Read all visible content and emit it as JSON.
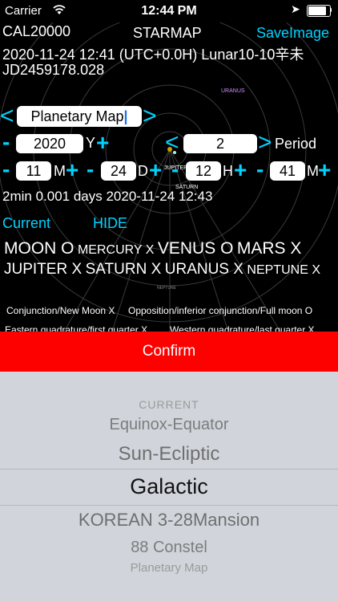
{
  "status": {
    "carrier": "Carrier",
    "time": "12:44 PM"
  },
  "header": {
    "app_id": "CAL20000",
    "title": "STARMAP",
    "save_label": "SaveImage",
    "datetime_line": "2020-11-24 12:41 (UTC+0.0H) Lunar10-10辛未",
    "jd_line": "JD2459178.028"
  },
  "map_labels": {
    "uranus": "URANUS",
    "jupiter": "JUPITER",
    "saturn": "SATURN",
    "neptune": "NEPTUNE"
  },
  "map_mode": {
    "value": "Planetary Map"
  },
  "year": {
    "value": "2020",
    "unit": "Y"
  },
  "period": {
    "value": "2",
    "unit": "Period"
  },
  "month": {
    "value": "11",
    "unit": "M"
  },
  "day": {
    "value": "24",
    "unit": "D"
  },
  "hour": {
    "value": "12",
    "unit": "H"
  },
  "minute": {
    "value": "41",
    "unit": "M"
  },
  "step_line": "2min 0.001 days 2020-11-24 12:43",
  "controls": {
    "current": "Current",
    "hide": "HIDE"
  },
  "planets_row1": [
    {
      "name": "MOON",
      "flag": "O"
    },
    {
      "name": "MERCURY",
      "flag": "X"
    },
    {
      "name": "VENUS",
      "flag": "O"
    },
    {
      "name": "MARS",
      "flag": "X"
    }
  ],
  "planets_row2": [
    {
      "name": "JUPITER",
      "flag": "X"
    },
    {
      "name": "SATURN",
      "flag": "X"
    },
    {
      "name": "URANUS",
      "flag": "X"
    },
    {
      "name": "NEPTUNE",
      "flag": "X"
    }
  ],
  "events": {
    "conjunction": "Conjunction/New Moon X",
    "opposition": "Opposition/inferior conjunction/Full moon O",
    "eastern": "Eastern quadrature/first quarter X",
    "western": "Western quadrature/last quarter X"
  },
  "confirm_label": "Confirm",
  "picker": {
    "options": [
      "CURRENT",
      "Equinox-Equator",
      "Sun-Ecliptic",
      "Galactic",
      "KOREAN 3-28Mansion",
      "88 Constel",
      "Planetary Map"
    ],
    "selected": "Galactic"
  },
  "colors": {
    "accent": "#00d3ff",
    "confirm": "#fd0000",
    "picker_bg": "#d1d5db"
  }
}
